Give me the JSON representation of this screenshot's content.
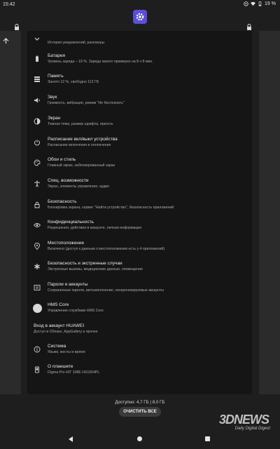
{
  "statusbar": {
    "time": "15:42",
    "battery": "19 %"
  },
  "settings": {
    "items": [
      {
        "id": "notifications",
        "title": "",
        "sub": "История уведомлений, разговоры",
        "icon": "chevron-icon"
      },
      {
        "id": "battery",
        "title": "Батарея",
        "sub": "Уровень заряда – 19 %. Заряда хватит примерно на 8 ч 8 мин.",
        "icon": "battery-icon"
      },
      {
        "id": "storage",
        "title": "Память",
        "sub": "Занято 12 %, свободно 112 ГБ",
        "icon": "storage-icon"
      },
      {
        "id": "sound",
        "title": "Звук",
        "sub": "Громкость, вибрация, режим \"Не беспокоить\"",
        "icon": "volume-icon"
      },
      {
        "id": "display",
        "title": "Экран",
        "sub": "Темная тема, размер шрифта, яркость",
        "icon": "display-icon"
      },
      {
        "id": "schedule",
        "title": "Расписание вкл/выкл устройства",
        "sub": "Расписание включения и отключения",
        "icon": "power-icon"
      },
      {
        "id": "wallpaper",
        "title": "Обои и стиль",
        "sub": "Главный экран, заблокированный экран",
        "icon": "palette-icon"
      },
      {
        "id": "accessibility",
        "title": "Спец. возможности",
        "sub": "Экран, элементы управления, аудио",
        "icon": "accessibility-icon"
      },
      {
        "id": "security",
        "title": "Безопасность",
        "sub": "Блокировка экрана, сервис \"Найти устройство\", безопасность приложений",
        "icon": "lock-icon"
      },
      {
        "id": "privacy",
        "title": "Конфиденциальность",
        "sub": "Разрешения, действия в аккаунте, личная информация",
        "icon": "privacy-icon"
      },
      {
        "id": "location",
        "title": "Местоположение",
        "sub": "Включено (доступ к данным о местоположении есть у 4 приложений)",
        "icon": "location-icon"
      },
      {
        "id": "emergency",
        "title": "Безопасность и экстренные случаи",
        "sub": "Экстренные вызовы, медицинские данные, оповещения",
        "icon": "asterisk-icon"
      },
      {
        "id": "passwords",
        "title": "Пароли и аккаунты",
        "sub": "Сохраненные пароли, автозаполнение, синхронизируемые аккаунты",
        "icon": "accounts-icon"
      },
      {
        "id": "hms",
        "title": "HMS Core",
        "sub": "Управление службами HMS Core",
        "icon": "hms-icon"
      },
      {
        "id": "huawei",
        "title": "Вход в аккаунт HUAWEI",
        "sub": "Доступ в Облако, AppGallery и прочее",
        "icon": ""
      },
      {
        "id": "system",
        "title": "Система",
        "sub": "Языки, жесты и время",
        "icon": "info-icon"
      },
      {
        "id": "tablet",
        "title": "О планшете",
        "sub": "Digma Pro HIT 108E HS1004PL",
        "icon": "tablet-icon"
      }
    ]
  },
  "recents": {
    "available": "Доступно: 4,7 ГБ | 8,0 ГБ",
    "clear_label": "ОЧИСТИТЬ ВСЕ"
  },
  "watermark": {
    "big": "3DNEWS",
    "small": "Daily Digital Digest"
  }
}
